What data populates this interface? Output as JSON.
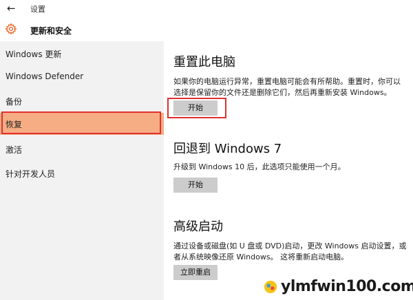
{
  "window": {
    "title": "设置",
    "back_icon": "back-arrow-icon"
  },
  "header": {
    "title": "更新和安全",
    "icon": "gear-icon",
    "icon_color": "#e8733a"
  },
  "sidebar": {
    "items": [
      {
        "label": "Windows 更新",
        "selected": false
      },
      {
        "label": "Windows Defender",
        "selected": false
      },
      {
        "label": "备份",
        "selected": false
      },
      {
        "label": "恢复",
        "selected": true
      },
      {
        "label": "激活",
        "selected": false
      },
      {
        "label": "针对开发人员",
        "selected": false
      }
    ],
    "selected_color": "#f6ad84",
    "highlight_color": "#e0302f"
  },
  "main": {
    "sections": [
      {
        "title": "重置此电脑",
        "description": "如果你的电脑运行异常，重置电脑可能会有所帮助。重置时，你可以选择是保留你的文件还是删除它们，然后再重新安装 Windows。",
        "button_label": "开始"
      },
      {
        "title": "回退到 Windows 7",
        "description": "升级到 Windows 10 后，此选项只能使用一个月。",
        "button_label": "开始"
      },
      {
        "title": "高级启动",
        "description": "通过设备或磁盘(如 U 盘或 DVD)启动，更改 Windows 启动设置，或者从系统映像还原 Windows。 这将重新启动电脑。",
        "button_label": "立即重启"
      }
    ]
  },
  "watermark": {
    "text": "ylmfwin100.com"
  }
}
